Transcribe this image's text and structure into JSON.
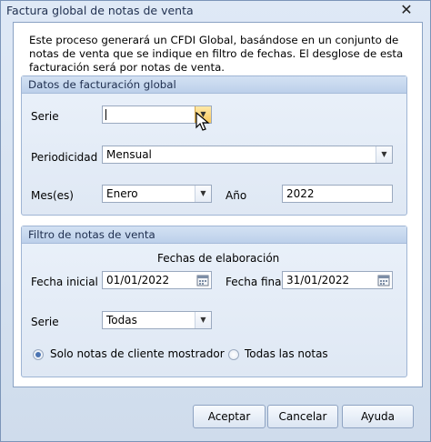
{
  "window": {
    "title": "Factura global de notas de venta",
    "close_glyph": "✕"
  },
  "description": "Este proceso generará un CFDI Global, basándose en un conjunto de notas de venta que se indique en filtro de fechas. El desglose de esta facturación será por notas de venta.",
  "billing_group": {
    "title": "Datos de facturación global",
    "serie": {
      "label": "Serie",
      "value": ""
    },
    "periodicidad": {
      "label": "Periodicidad",
      "value": "Mensual"
    },
    "mes": {
      "label": "Mes(es)",
      "value": "Enero"
    },
    "anio": {
      "label": "Año",
      "value": "2022"
    }
  },
  "filter_group": {
    "title": "Filtro de notas de venta",
    "dates_heading": "Fechas de elaboración",
    "fecha_inicial": {
      "label": "Fecha inicial",
      "value": "01/01/2022"
    },
    "fecha_final": {
      "label": "Fecha final",
      "value": "31/01/2022"
    },
    "serie": {
      "label": "Serie",
      "value": "Todas"
    },
    "radio_mostrador": {
      "label": "Solo notas de cliente mostrador",
      "selected": true
    },
    "radio_todas": {
      "label": "Todas las notas",
      "selected": false
    }
  },
  "buttons": {
    "aceptar": "Aceptar",
    "cancelar": "Cancelar",
    "ayuda": "Ayuda"
  },
  "icons": {
    "dropdown": "chevron-down-icon",
    "calendar": "calendar-icon",
    "cursor": "mouse-pointer-icon"
  },
  "colors": {
    "accent": "#4b74b3",
    "group_header": "#c6d7ee",
    "hot_dropdown": "#f9c75a"
  }
}
